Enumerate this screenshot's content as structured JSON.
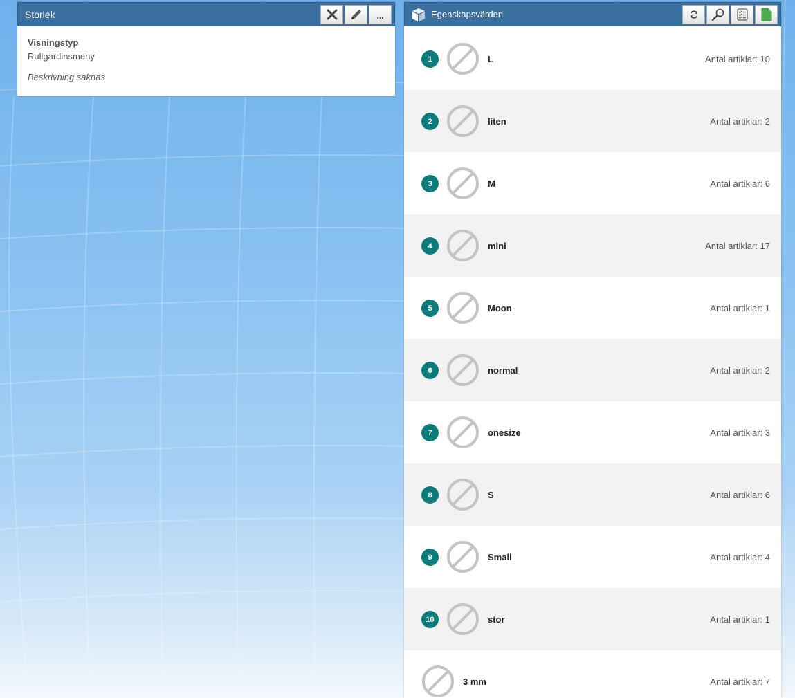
{
  "left_panel": {
    "title": "Storlek",
    "display_type_label": "Visningstyp",
    "display_type_value": "Rullgardinsmeny",
    "description": "Beskrivning saknas",
    "more_label": "..."
  },
  "right_panel": {
    "title": "Egenskapsvärden",
    "count_prefix": "Antal artiklar:",
    "rows": [
      {
        "index": "1",
        "name": "L",
        "count": "Antal artiklar: 10"
      },
      {
        "index": "2",
        "name": "liten",
        "count": "Antal artiklar: 2"
      },
      {
        "index": "3",
        "name": "M",
        "count": "Antal artiklar: 6"
      },
      {
        "index": "4",
        "name": "mini",
        "count": "Antal artiklar: 17"
      },
      {
        "index": "5",
        "name": "Moon",
        "count": "Antal artiklar: 1"
      },
      {
        "index": "6",
        "name": "normal",
        "count": "Antal artiklar: 2"
      },
      {
        "index": "7",
        "name": "onesize",
        "count": "Antal artiklar: 3"
      },
      {
        "index": "8",
        "name": "S",
        "count": "Antal artiklar: 6"
      },
      {
        "index": "9",
        "name": "Small",
        "count": "Antal artiklar: 4"
      },
      {
        "index": "10",
        "name": "stor",
        "count": "Antal artiklar: 1"
      },
      {
        "index": "",
        "name": "3 mm",
        "count": "Antal artiklar: 7"
      }
    ]
  },
  "colors": {
    "titlebar": "#3a6f9f",
    "badge": "#0e7b7b",
    "row_alt": "#f2f2f2"
  },
  "icons": {
    "close": "close-icon",
    "edit": "pencil-icon",
    "refresh": "refresh-icon",
    "search": "magnifier-icon",
    "checklist": "checklist-icon",
    "document": "document-icon",
    "no_image": "no-image-icon"
  }
}
